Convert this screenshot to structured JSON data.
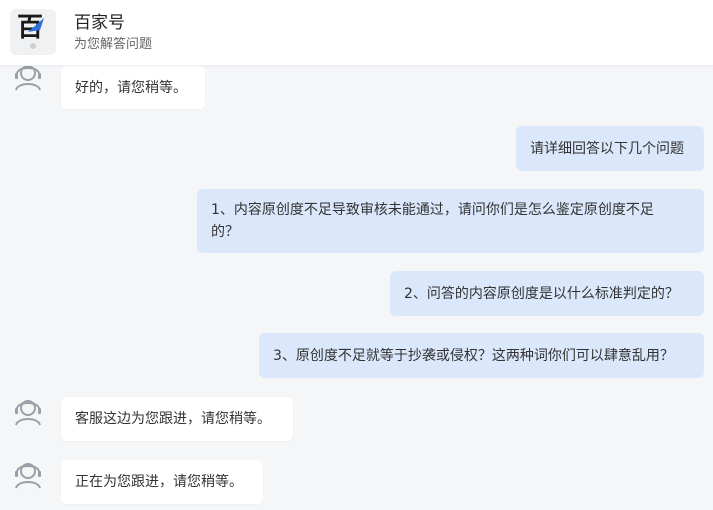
{
  "header": {
    "title": "百家号",
    "subtitle": "为您解答问题",
    "logo_icon": "baijiahao-logo"
  },
  "messages": [
    {
      "sender": "agent",
      "text": "好的，请您稍等。"
    },
    {
      "sender": "user",
      "text": "请详细回答以下几个问题"
    },
    {
      "sender": "user",
      "text": "1、内容原创度不足导致审核未能通过，请问你们是怎么鉴定原创度不足的？"
    },
    {
      "sender": "user",
      "text": "2、问答的内容原创度是以什么标准判定的？"
    },
    {
      "sender": "user",
      "text": "3、原创度不足就等于抄袭或侵权？这两种词你们可以肆意乱用？"
    },
    {
      "sender": "agent",
      "text": "客服这边为您跟进，请您稍等。"
    },
    {
      "sender": "agent",
      "text": "正在为您跟进，请您稍等。"
    }
  ],
  "colors": {
    "background": "#f5f6f8",
    "user_bubble": "#dbe7fb",
    "agent_bubble": "#ffffff",
    "avatar_stroke": "#9aa0a8"
  },
  "icons": {
    "agent_avatar": "agent-avatar-icon"
  }
}
